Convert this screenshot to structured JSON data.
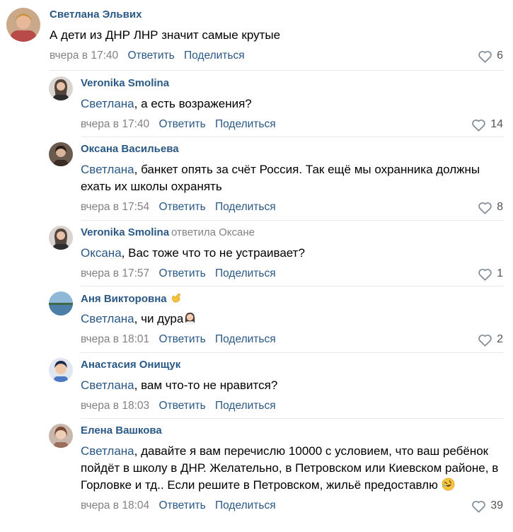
{
  "comments": [
    {
      "author": "Светлана Эльвих",
      "reply_to": "",
      "text_plain": "А дети из ДНР ЛНР значит самые крутые",
      "mention": "",
      "text_rest": "",
      "time": "вчера в 17:40",
      "reply_label": "Ответить",
      "share_label": "Поделиться",
      "likes": "6"
    },
    {
      "author": "Veronika Smolina",
      "reply_to": "",
      "mention": "Светлана",
      "text_rest": ", а есть возражения?",
      "time": "вчера в 17:40",
      "reply_label": "Ответить",
      "share_label": "Поделиться",
      "likes": "14"
    },
    {
      "author": "Оксана Васильева",
      "reply_to": "",
      "mention": "Светлана",
      "text_rest": ", банкет опять за счёт Россия. Так ещё мы охранника должны ехать их школы охранять",
      "time": "вчера в 17:54",
      "reply_label": "Ответить",
      "share_label": "Поделиться",
      "likes": "8"
    },
    {
      "author": "Veronika Smolina",
      "reply_to": "ответила Оксане",
      "mention": "Оксана",
      "text_rest": ", Вас тоже что то не устраивает?",
      "time": "вчера в 17:57",
      "reply_label": "Ответить",
      "share_label": "Поделиться",
      "likes": "1"
    },
    {
      "author": "Аня Викторовна",
      "reply_to": "",
      "mention": "Светлана",
      "text_rest": ", чи дура",
      "time": "вчера в 18:01",
      "reply_label": "Ответить",
      "share_label": "Поделиться",
      "likes": "2"
    },
    {
      "author": "Анастасия Онищук",
      "reply_to": "",
      "mention": "Светлана",
      "text_rest": ", вам что-то не нравится?",
      "time": "вчера в 18:03",
      "reply_label": "Ответить",
      "share_label": "Поделиться",
      "likes": ""
    },
    {
      "author": "Елена Вашкова",
      "reply_to": "",
      "mention": "Светлана",
      "text_rest": ", давайте я вам перечислю 10000 с условием, что ваш ребёнок пойдёт в школу в ДНР. Желательно, в Петровском или Киевском районе, в Горловке и тд.. Если решите в Петровском, жильё предоставлю",
      "time": "вчера в 18:04",
      "reply_label": "Ответить",
      "share_label": "Поделиться",
      "likes": "39"
    }
  ],
  "colors": {
    "link": "#2a5885",
    "meta": "#828282",
    "divider": "#e7e8ec"
  },
  "icons": {
    "like": "heart-outline-icon",
    "author_badge": "call-me-hand-emoji",
    "facepalm": "woman-facepalming-emoji",
    "laugh": "rolling-laughing-emoji"
  }
}
